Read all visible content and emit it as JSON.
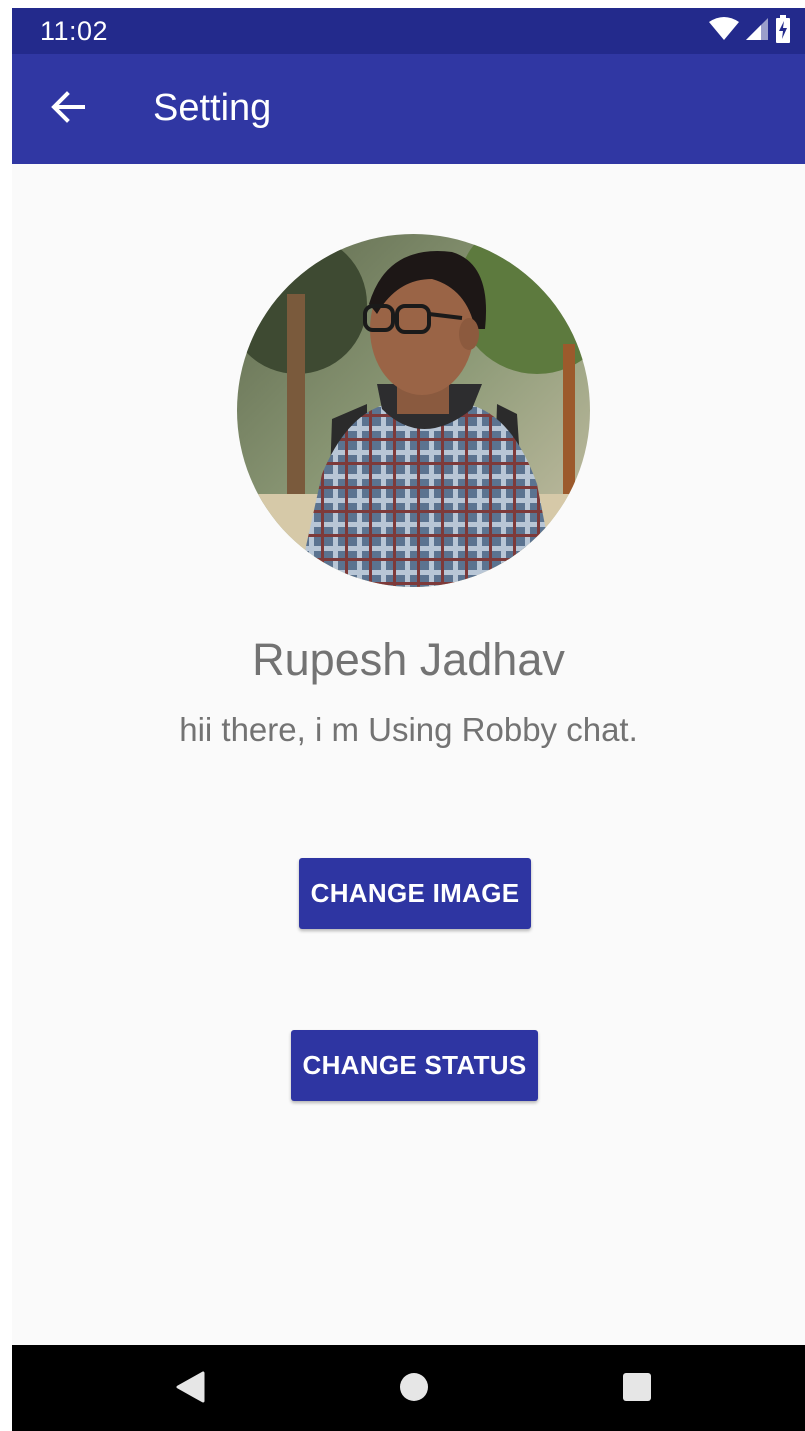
{
  "status_bar": {
    "time": "11:02",
    "icons": [
      "wifi-icon",
      "cell-signal-icon",
      "battery-charging-icon"
    ]
  },
  "app_bar": {
    "title": "Setting",
    "back_icon": "arrow-back-icon"
  },
  "profile": {
    "name": "Rupesh Jadhav",
    "status": "hii there, i m Using Robby chat.",
    "avatar": "profile-photo"
  },
  "actions": {
    "change_image_label": "CHANGE IMAGE",
    "change_status_label": "CHANGE STATUS"
  },
  "nav_bar": {
    "items": [
      "back-triangle-icon",
      "home-circle-icon",
      "recents-square-icon"
    ]
  },
  "colors": {
    "status_bar": "#232a8c",
    "app_bar": "#3037a3",
    "button": "#2e35a2",
    "background": "#fafafa",
    "text_secondary": "#737373"
  }
}
